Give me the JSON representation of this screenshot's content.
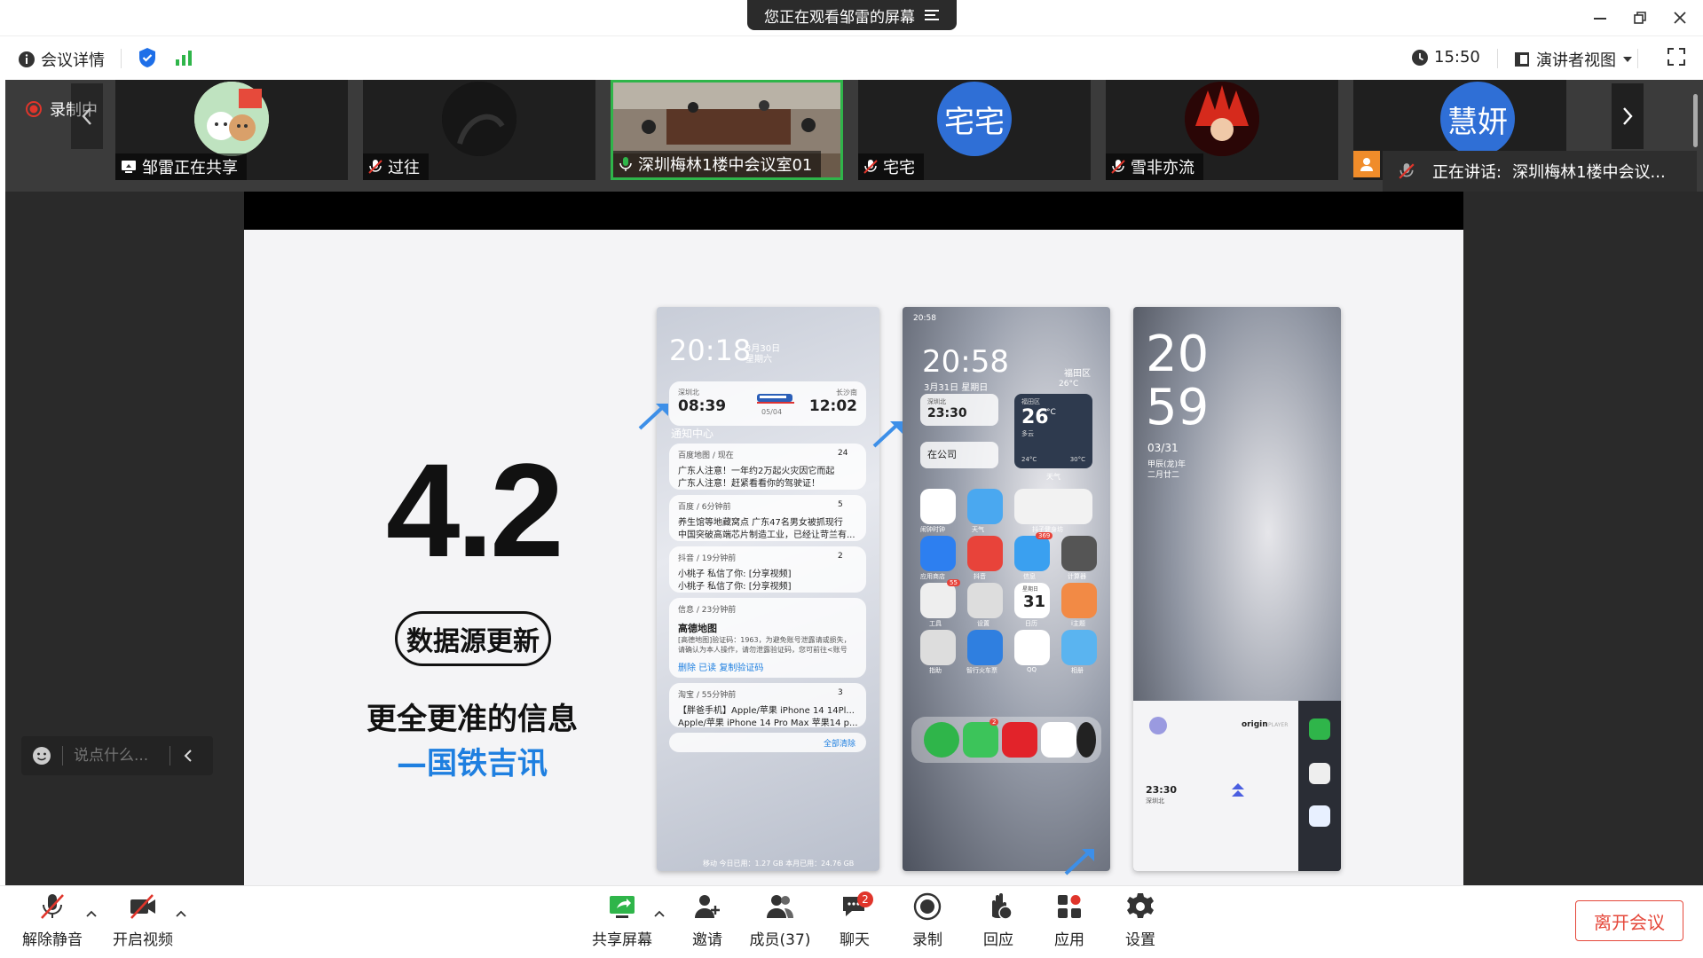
{
  "window": {
    "share_banner": "您正在观看邹雷的屏幕",
    "menu_icon": "menu-lines-icon"
  },
  "infobar": {
    "meeting_details": "会议详情",
    "time": "15:50",
    "view_mode": "演讲者视图"
  },
  "strip": {
    "recording": "录制中",
    "tiles": [
      {
        "name": "邹雷正在共享"
      },
      {
        "name": "过往"
      },
      {
        "name": "深圳梅林1楼中会议室01"
      },
      {
        "name": "宅宅",
        "avatar_text": "宅宅"
      },
      {
        "name": "雪非亦流"
      },
      {
        "avatar_text": "慧妍"
      }
    ],
    "speaking_label": "正在讲话:",
    "speaking_name": "深圳梅林1楼中会议..."
  },
  "chat_box": {
    "placeholder": "说点什么..."
  },
  "slide": {
    "version": "4.2",
    "badge": "数据源更新",
    "subtitle": "更全更准的信息",
    "brand": "—国铁吉讯"
  },
  "phone1": {
    "time": "20:18",
    "date": "3月30日",
    "weekday": "星期六",
    "train_from": "深圳北",
    "train_to": "长沙南",
    "dep": "08:39",
    "arr": "12:02",
    "train_date": "05/04",
    "center": "通知中心",
    "n1_src": "百度地图 / 现在",
    "n1_count": "24",
    "n1_l1": "广东人注意！一年约2万起火灾因它而起",
    "n1_l2": "广东人注意！赶紧看看你的驾驶证！",
    "n2_src": "百度 / 6分钟前",
    "n2_count": "5",
    "n2_l1": "养生馆等地藏窝点 广东47名男女被抓现行",
    "n2_l2": "中国突破高端芯片制造工业，已经让苛兰有...",
    "n3_src": "抖音 / 19分钟前",
    "n3_count": "2",
    "n3_l1": "小桃子  私信了你: [分享视频]",
    "n3_l2": "小桃子  私信了你: [分享视频]",
    "n4_src": "信息 / 23分钟前",
    "n4_title": "高德地图",
    "n4_l1": "[高德地图]验证码：1963，为避免账号泄露请或损失，",
    "n4_l2": "请确认为本人操作，请勿泄露验证码，您可前往<账号",
    "n4_actions": "删除    已读    复制验证码",
    "n5_src": "淘宝 / 55分钟前",
    "n5_count": "3",
    "n5_l1": "【胖爸手机】Apple/苹果 iPhone 14 14Pl...",
    "n5_l2": "Apple/苹果 iPhone 14 Pro Max 苹果14 p...",
    "clear": "全部清除",
    "footer": "移动 今日已用：1.27 GB  本月已用：24.76 GB"
  },
  "phone2": {
    "status_time": "20:58",
    "time": "20:58",
    "date": "3月31日 星期日",
    "district": "福田区",
    "temp_small": "26°C",
    "card_from": "深圳北",
    "card_time": "23:30",
    "weather_place": "福田区",
    "temp_big": "26",
    "temp_unit": "°C",
    "weather_desc": "多云",
    "low": "24°C",
    "high": "30°C",
    "weather_label": "天气",
    "office": "在公司",
    "r1": [
      "闹钟时钟",
      "天气",
      "抖子健身坊"
    ],
    "r2": [
      "应用商店",
      "抖音",
      "信息",
      "计算器"
    ],
    "r3": [
      "工具",
      "设置",
      "日历",
      "i主题"
    ],
    "r4": [
      "指助",
      "智行火车票",
      "QQ",
      "相册"
    ],
    "cal_day": "31",
    "cal_week": "星期日",
    "badge_a": "55",
    "badge_b": "369",
    "badge_c": "2"
  },
  "phone3": {
    "hour": "20",
    "minute": "59",
    "date": "03/31",
    "lunar1": "甲辰(龙)年",
    "lunar2": "二月廿二",
    "player_brand": "origin",
    "player_sub": "PLAYER",
    "card_time": "23:30",
    "card_from": "深圳北"
  },
  "toolbar": {
    "unmute": "解除静音",
    "start_video": "开启视频",
    "share": "共享屏幕",
    "invite": "邀请",
    "members": "成员(37)",
    "chat": "聊天",
    "chat_badge": "2",
    "record": "录制",
    "react": "回应",
    "apps": "应用",
    "settings": "设置",
    "leave": "离开会议"
  },
  "colors": {
    "accent_blue": "#1e6fe8",
    "record_red": "#e0352b",
    "leave_red": "#e5483b",
    "active_green": "#2fb54a",
    "brand_text_blue": "#1e7fe0"
  }
}
